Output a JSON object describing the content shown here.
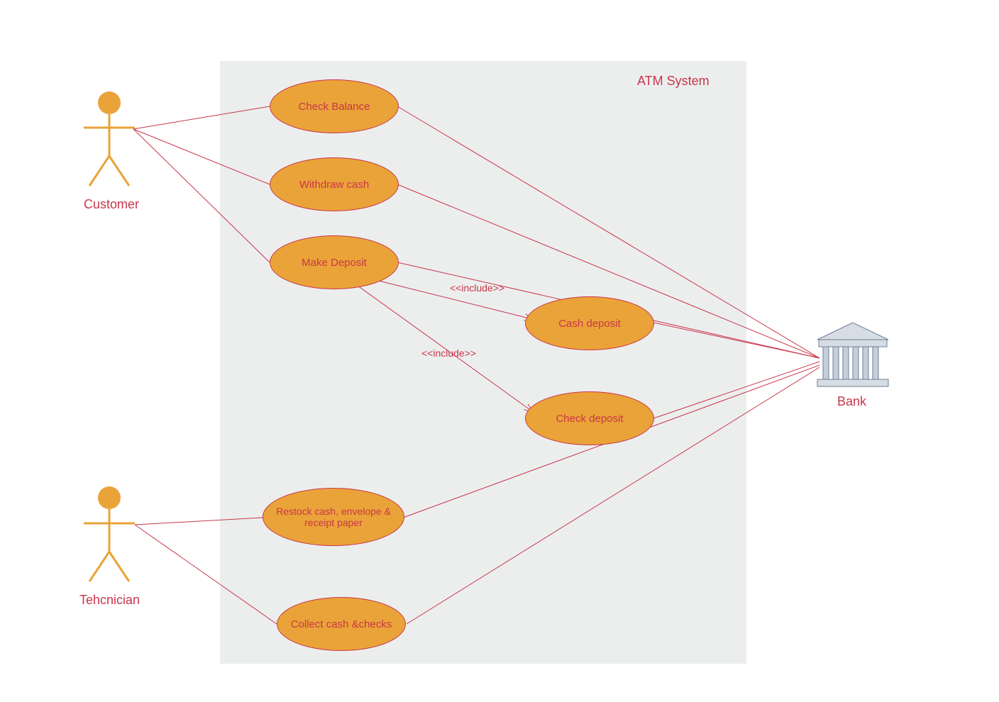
{
  "system": {
    "title": "ATM System"
  },
  "actors": {
    "customer": "Customer",
    "technician": "Tehcnician",
    "bank": "Bank"
  },
  "usecases": {
    "checkBalance": "Check Balance",
    "withdraw": "Withdraw cash",
    "makeDeposit": "Make Deposit",
    "cashDeposit": "Cash deposit",
    "checkDeposit": "Check deposit",
    "restock": "Restock cash, envelope & receipt paper",
    "collect": "Collect cash &checks"
  },
  "relations": {
    "include1": "<<include>>",
    "include2": "<<include>>"
  }
}
